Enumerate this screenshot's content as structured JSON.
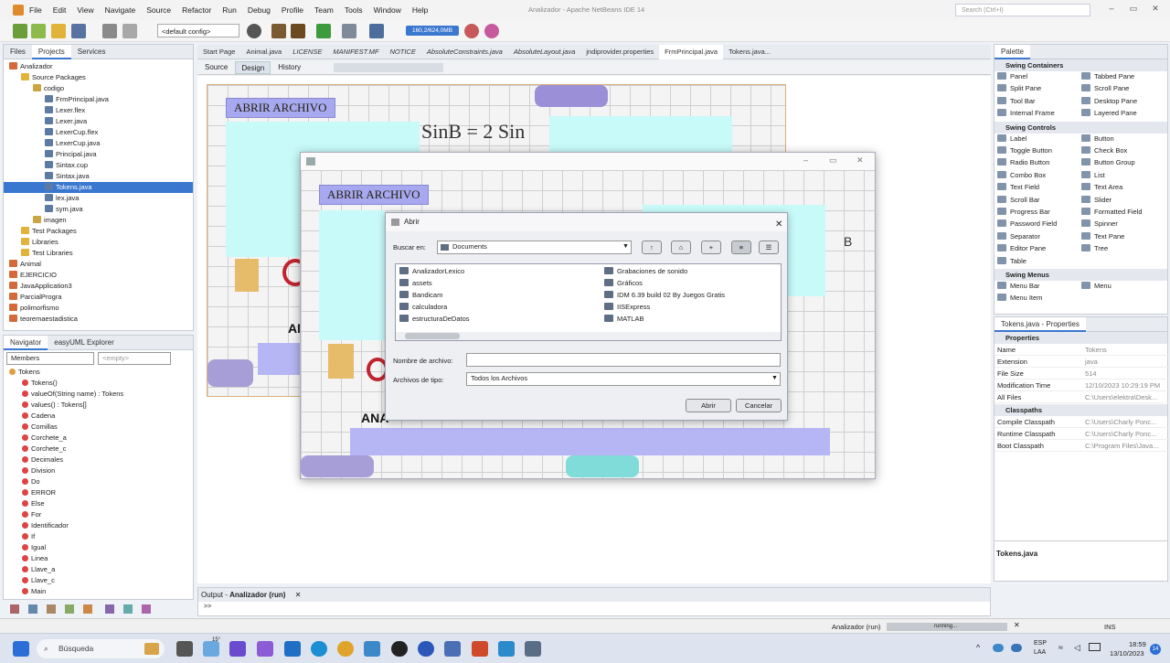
{
  "window": {
    "title": "Analizador - Apache NetBeans IDE 14",
    "search_placeholder": "Search (Ctrl+I)"
  },
  "menu": [
    "File",
    "Edit",
    "View",
    "Navigate",
    "Source",
    "Refactor",
    "Run",
    "Debug",
    "Profile",
    "Team",
    "Tools",
    "Window",
    "Help"
  ],
  "toolbar": {
    "config": "<default config>",
    "memory": "160,2/624,0MB"
  },
  "projects": {
    "tabs": [
      "Files",
      "Projects",
      "Services"
    ],
    "tree": [
      {
        "label": "Analizador",
        "depth": 0,
        "kind": "project"
      },
      {
        "label": "Source Packages",
        "depth": 1,
        "kind": "folder"
      },
      {
        "label": "codigo",
        "depth": 2,
        "kind": "package"
      },
      {
        "label": "FrmPrincipal.java",
        "depth": 3,
        "kind": "file"
      },
      {
        "label": "Lexer.flex",
        "depth": 3,
        "kind": "file"
      },
      {
        "label": "Lexer.java",
        "depth": 3,
        "kind": "file"
      },
      {
        "label": "LexerCup.flex",
        "depth": 3,
        "kind": "file"
      },
      {
        "label": "LexerCup.java",
        "depth": 3,
        "kind": "file"
      },
      {
        "label": "Principal.java",
        "depth": 3,
        "kind": "file"
      },
      {
        "label": "Sintax.cup",
        "depth": 3,
        "kind": "file"
      },
      {
        "label": "Sintax.java",
        "depth": 3,
        "kind": "file"
      },
      {
        "label": "Tokens.java",
        "depth": 3,
        "kind": "file",
        "selected": true
      },
      {
        "label": "lex.java",
        "depth": 3,
        "kind": "file"
      },
      {
        "label": "sym.java",
        "depth": 3,
        "kind": "file"
      },
      {
        "label": "imagen",
        "depth": 2,
        "kind": "package"
      },
      {
        "label": "Test Packages",
        "depth": 1,
        "kind": "folder"
      },
      {
        "label": "Libraries",
        "depth": 1,
        "kind": "folder"
      },
      {
        "label": "Test Libraries",
        "depth": 1,
        "kind": "folder"
      },
      {
        "label": "Animal",
        "depth": 0,
        "kind": "project"
      },
      {
        "label": "EJERCICIO",
        "depth": 0,
        "kind": "project"
      },
      {
        "label": "JavaApplication3",
        "depth": 0,
        "kind": "project"
      },
      {
        "label": "ParcialProgra",
        "depth": 0,
        "kind": "project"
      },
      {
        "label": "polimorfismo",
        "depth": 0,
        "kind": "project"
      },
      {
        "label": "teoremaestadistica",
        "depth": 0,
        "kind": "project"
      }
    ]
  },
  "navigator": {
    "tabs": [
      "Navigator",
      "easyUML Explorer"
    ],
    "filter": "Members",
    "empty": "<empty>",
    "items": [
      {
        "label": "Tokens",
        "depth": 0
      },
      {
        "label": "Tokens()",
        "depth": 1
      },
      {
        "label": "valueOf(String name) : Tokens",
        "depth": 1
      },
      {
        "label": "values() : Tokens[]",
        "depth": 1
      },
      {
        "label": "Cadena",
        "depth": 1
      },
      {
        "label": "Comillas",
        "depth": 1
      },
      {
        "label": "Corchete_a",
        "depth": 1
      },
      {
        "label": "Corchete_c",
        "depth": 1
      },
      {
        "label": "Decimales",
        "depth": 1
      },
      {
        "label": "Division",
        "depth": 1
      },
      {
        "label": "Do",
        "depth": 1
      },
      {
        "label": "ERROR",
        "depth": 1
      },
      {
        "label": "Else",
        "depth": 1
      },
      {
        "label": "For",
        "depth": 1
      },
      {
        "label": "Identificador",
        "depth": 1
      },
      {
        "label": "If",
        "depth": 1
      },
      {
        "label": "Igual",
        "depth": 1
      },
      {
        "label": "Linea",
        "depth": 1
      },
      {
        "label": "Llave_a",
        "depth": 1
      },
      {
        "label": "Llave_c",
        "depth": 1
      },
      {
        "label": "Main",
        "depth": 1
      }
    ]
  },
  "editor": {
    "tabs": [
      "Start Page",
      "Animal.java",
      "LICENSE",
      "MANIFEST.MF",
      "NOTICE",
      "AbsoluteConstraints.java",
      "AbsoluteLayout.java",
      "jndiprovider.properties",
      "FrmPrincipal.java",
      "Tokens.java..."
    ],
    "subtabs": [
      "Source",
      "Design",
      "History"
    ],
    "form": {
      "button_label": "ABRIR ARCHIVO",
      "formula": "SinB = 2 Sin",
      "ana": "ANAI",
      "b": "b",
      "c": "c"
    }
  },
  "running_form": {
    "button_label": "ABRIR ARCHIVO",
    "ana": "ANA",
    "b": "b",
    "c": "c",
    "B": "B"
  },
  "dialog": {
    "title": "Abrir",
    "lookin_label": "Buscar en:",
    "lookin_value": "Documents",
    "files_left": [
      "AnalizadorLexico",
      "assets",
      "Bandicam",
      "calculadora",
      "estructuraDeDatos"
    ],
    "files_right": [
      "Grabaciones de sonido",
      "Gráficos",
      "IDM 6.39 build 02 By Juegos Gratis",
      "IISExpress",
      "MATLAB"
    ],
    "filename_label": "Nombre de archivo:",
    "filetype_label": "Archivos de tipo:",
    "filetype_value": "Todos los Archivos",
    "open": "Abrir",
    "cancel": "Cancelar"
  },
  "palette": {
    "title": "Palette",
    "sections": [
      {
        "name": "Swing Containers",
        "items": [
          "Panel",
          "Tabbed Pane",
          "Split Pane",
          "Scroll Pane",
          "Tool Bar",
          "Desktop Pane",
          "Internal Frame",
          "Layered Pane"
        ]
      },
      {
        "name": "Swing Controls",
        "items": [
          "Label",
          "Button",
          "Toggle Button",
          "Check Box",
          "Radio Button",
          "Button Group",
          "Combo Box",
          "List",
          "Text Field",
          "Text Area",
          "Scroll Bar",
          "Slider",
          "Progress Bar",
          "Formatted Field",
          "Password Field",
          "Spinner",
          "Separator",
          "Text Pane",
          "Editor Pane",
          "Tree",
          "Table"
        ]
      },
      {
        "name": "Swing Menus",
        "items": [
          "Menu Bar",
          "Menu",
          "Menu Item"
        ]
      }
    ]
  },
  "properties": {
    "title": "Tokens.java - Properties",
    "section": "Properties",
    "rows": [
      [
        "Name",
        "Tokens"
      ],
      [
        "Extension",
        "java"
      ],
      [
        "File Size",
        "514"
      ],
      [
        "Modification Time",
        "12/10/2023 10:29:19 PM"
      ],
      [
        "All Files",
        "C:\\Users\\elektra\\Desk..."
      ]
    ],
    "section2": "Classpaths",
    "rows2": [
      [
        "Compile Classpath",
        "C:\\Users\\Charly Ponc..."
      ],
      [
        "Runtime Classpath",
        "C:\\Users\\Charly Ponc..."
      ],
      [
        "Boot Classpath",
        "C:\\Program Files\\Java..."
      ]
    ],
    "footer": "Tokens.java"
  },
  "output": {
    "label": "Output - ",
    "bold": "Analizador (run)",
    "prompt": ">>"
  },
  "status": {
    "task": "Analizador (run)",
    "progress": "running...",
    "mode": "INS"
  },
  "taskbar": {
    "search": "Búsqueda",
    "weather": "15°",
    "lang": "ESP",
    "region": "LAA",
    "time": "18:59",
    "date": "13/10/2023",
    "badge": "14"
  }
}
